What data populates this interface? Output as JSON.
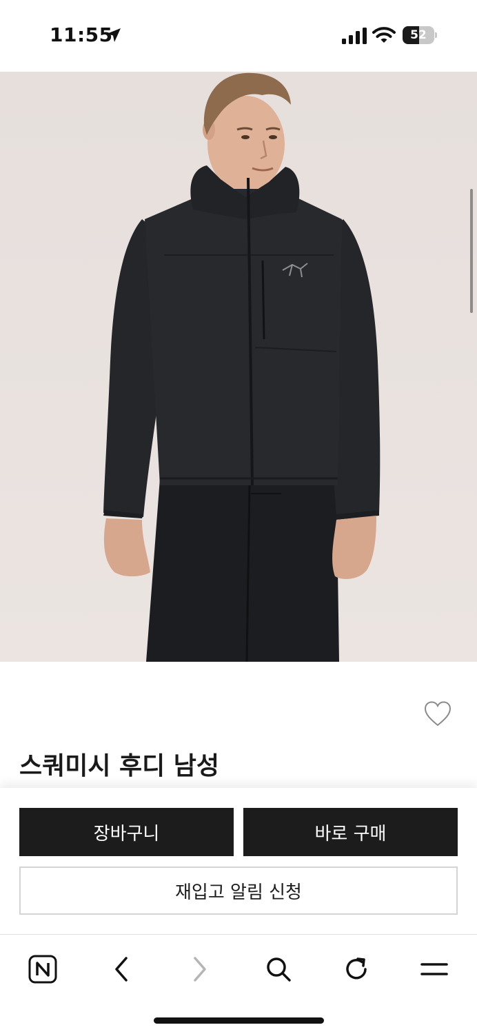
{
  "status_bar": {
    "time": "11:55",
    "battery_level": "52",
    "battery_fraction": 0.52,
    "icons": [
      "location-arrow-icon",
      "cellular-signal-icon",
      "wifi-icon",
      "battery-icon"
    ]
  },
  "product": {
    "image_alt": "",
    "title": "스쿼미시 후디 남성",
    "wishlist_icon": "heart-outline-icon"
  },
  "actions": {
    "cart_label": "장바구니",
    "buy_label": "바로 구매",
    "restock_label": "재입고 알림 신청"
  },
  "browser_toolbar": {
    "icons": [
      "naver-n-icon",
      "back-chevron-icon",
      "forward-chevron-icon",
      "search-icon",
      "reload-icon",
      "menu-icon"
    ],
    "forward_enabled": false
  },
  "colors": {
    "button_dark": "#1c1c1c",
    "image_background": "#e8e1de",
    "jacket": "#26272b"
  }
}
